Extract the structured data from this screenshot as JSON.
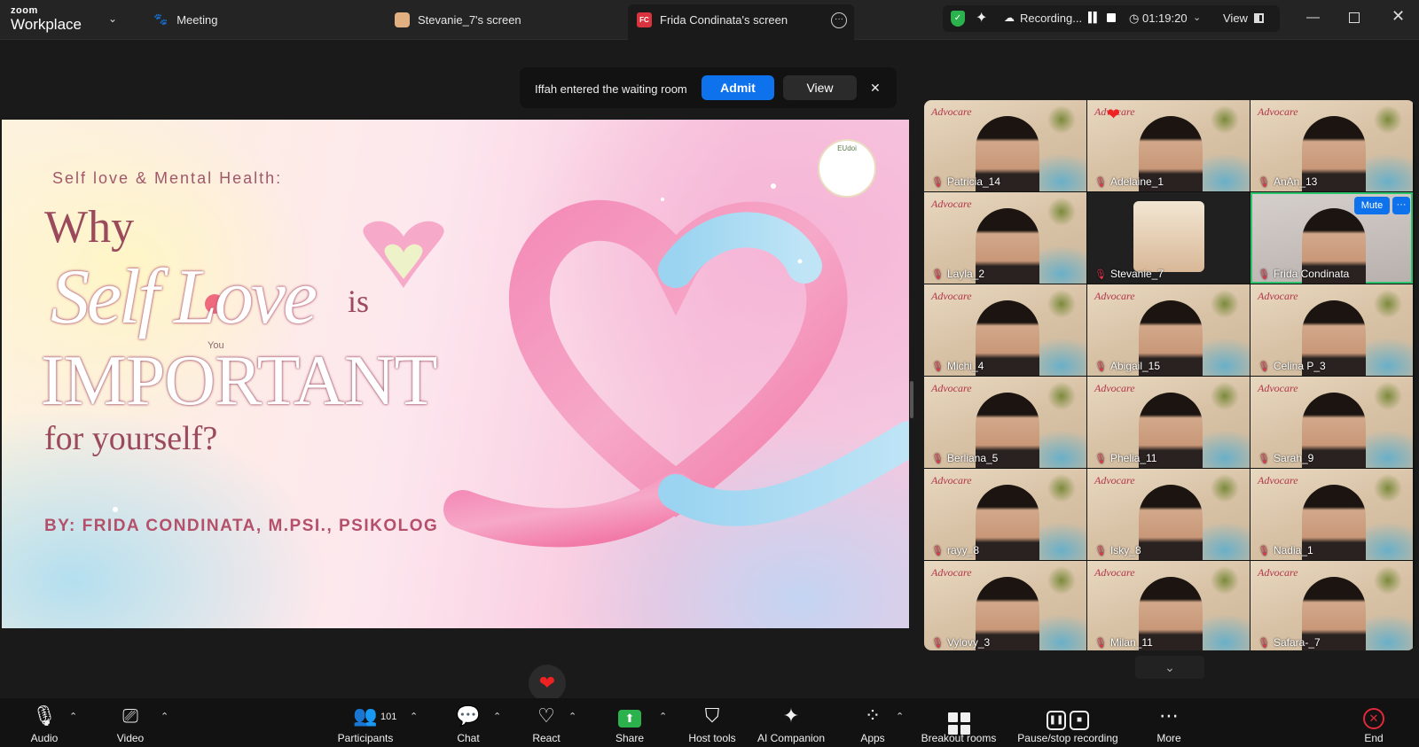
{
  "app": {
    "brand_top": "zoom",
    "brand_bottom": "Workplace"
  },
  "topbar": {
    "meeting_label": "Meeting",
    "tabs": [
      {
        "label": "Stevanie_7's screen"
      },
      {
        "label": "Frida Condinata's screen",
        "badge": "FC"
      }
    ],
    "recording_label": "Recording...",
    "timer": "01:19:20",
    "view_label": "View"
  },
  "notification": {
    "text": "Iffah entered the waiting room",
    "admit_label": "Admit",
    "view_label": "View"
  },
  "slide": {
    "subtitle": "Self love & Mental Health:",
    "line_why": "Why",
    "line_self_love": "Self Love",
    "line_is": "is",
    "line_you": "You",
    "line_important": "IMPORTANT",
    "line_for": "for yourself?",
    "byline": "BY: FRIDA CONDINATA, M.PSI., PSIKOLOG",
    "logo_text": "EUdoi"
  },
  "gallery": {
    "mute_label": "Mute",
    "more_label": "···",
    "participants": [
      {
        "name": "Patricia_14",
        "style": "bg"
      },
      {
        "name": "Adelaine_1",
        "style": "bg",
        "reaction": "heart"
      },
      {
        "name": "AnAn_13",
        "style": "bg"
      },
      {
        "name": "Layla_2",
        "style": "bg"
      },
      {
        "name": "Stevanie_7",
        "style": "photo"
      },
      {
        "name": "Frida Condinata",
        "style": "active"
      },
      {
        "name": "Michi_4",
        "style": "bg"
      },
      {
        "name": "Abigail_15",
        "style": "bg"
      },
      {
        "name": "Celina P_3",
        "style": "bg"
      },
      {
        "name": "Berliana_5",
        "style": "bg"
      },
      {
        "name": "Phelia_11",
        "style": "bg"
      },
      {
        "name": "Sarah_9",
        "style": "bg"
      },
      {
        "name": "rayy_8",
        "style": "bg"
      },
      {
        "name": "Isky_8",
        "style": "bg"
      },
      {
        "name": "Nadia_1",
        "style": "bg"
      },
      {
        "name": "Vylovy_3",
        "style": "bg"
      },
      {
        "name": "Milan_11",
        "style": "bg"
      },
      {
        "name": "Safara-_7",
        "style": "bg"
      }
    ]
  },
  "toolbar": {
    "audio": "Audio",
    "video": "Video",
    "participants": "Participants",
    "participant_count": "101",
    "chat": "Chat",
    "react": "React",
    "share": "Share",
    "host_tools": "Host tools",
    "ai_companion": "AI Companion",
    "apps": "Apps",
    "breakout_rooms": "Breakout rooms",
    "pause_stop_recording": "Pause/stop recording",
    "more": "More",
    "end": "End"
  },
  "colors": {
    "accent_blue": "#0e72ed",
    "active_speaker": "#2ec46d",
    "end_red": "#e02a3a",
    "share_green": "#2bb24c"
  }
}
